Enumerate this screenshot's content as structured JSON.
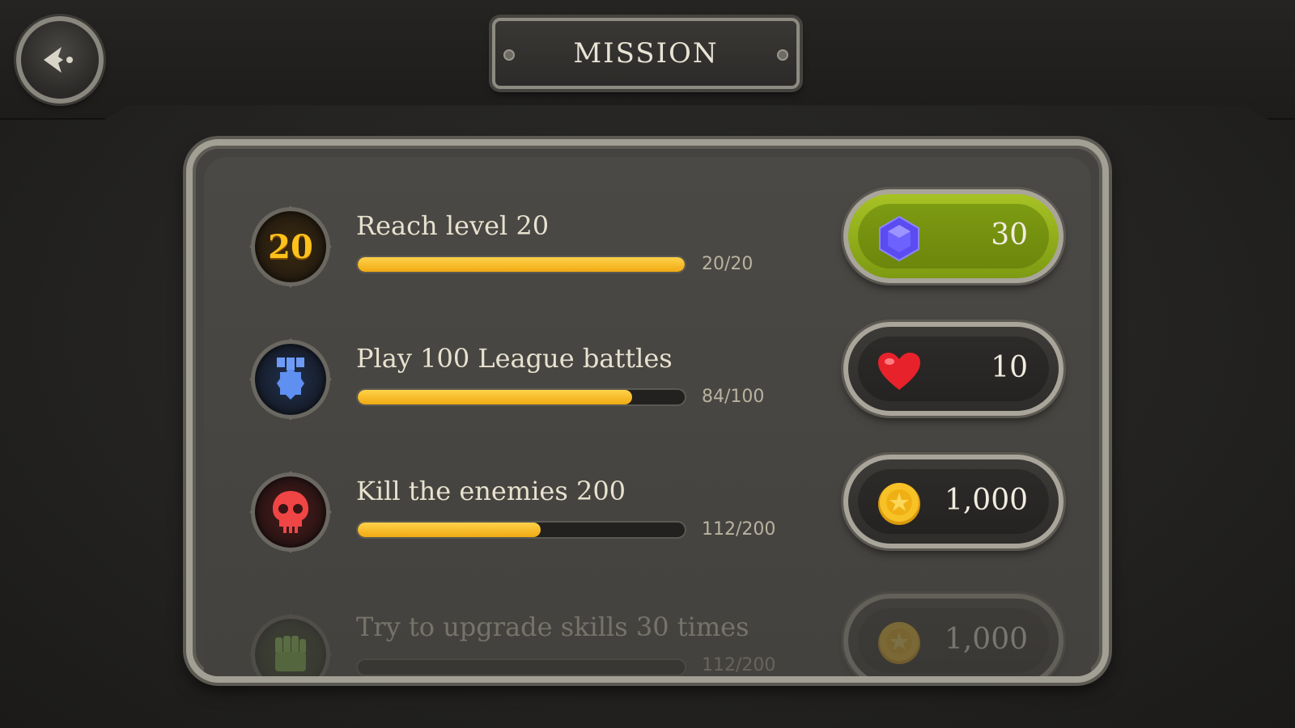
{
  "header": {
    "title": "MISSION"
  },
  "missions": [
    {
      "title": "Reach level 20",
      "progress": "20/20",
      "fraction": 1.0,
      "badge_text": "20",
      "badge_icon": "level-badge-icon",
      "reward_icon": "gem-icon",
      "reward_amount": "30",
      "claimable": true
    },
    {
      "title": "Play 100 League battles",
      "progress": "84/100",
      "fraction": 0.84,
      "badge_icon": "medal-icon",
      "reward_icon": "heart-icon",
      "reward_amount": "10",
      "claimable": false
    },
    {
      "title": "Kill the enemies 200",
      "progress": "112/200",
      "fraction": 0.56,
      "badge_icon": "skull-icon",
      "reward_icon": "coin-icon",
      "reward_amount": "1,000",
      "claimable": false
    },
    {
      "title": "Try to upgrade skills 30 times",
      "progress": "112/200",
      "fraction": 0.0,
      "badge_icon": "fist-icon",
      "reward_icon": "coin-icon",
      "reward_amount": "1,000",
      "claimable": false
    }
  ],
  "colors": {
    "progress": "#f5b71e",
    "claim_button": "#8caa16",
    "badge_number": "#ffc21a"
  }
}
